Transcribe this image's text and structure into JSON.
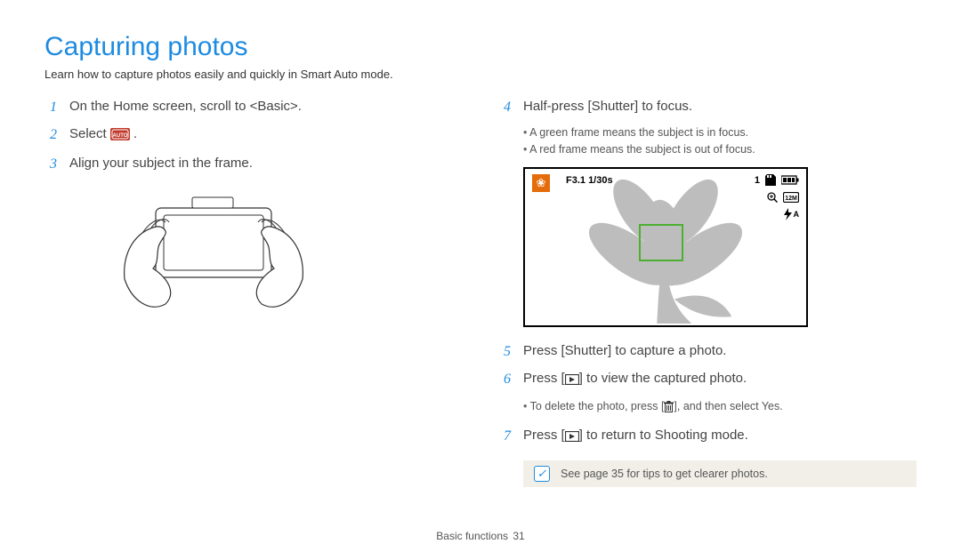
{
  "title": "Capturing photos",
  "intro": "Learn how to capture photos easily and quickly in Smart Auto mode.",
  "left": {
    "step1_num": "1",
    "step1_text": "On the Home screen, scroll to <Basic>.",
    "step2_num": "2",
    "step2_text_pre": "Select",
    "step2_text_post": ".",
    "step3_num": "3",
    "step3_text": "Align your subject in the frame."
  },
  "right": {
    "step4_num": "4",
    "step4_text": "Half-press [Shutter] to focus.",
    "step4_bullet1": "A green frame means the subject is in focus.",
    "step4_bullet2": "A red frame means the subject is out of focus.",
    "osd_exposure": "F3.1 1/30s",
    "osd_count": "1",
    "osd_flash_suffix": "A",
    "step5_num": "5",
    "step5_text": "Press [Shutter] to capture a photo.",
    "step6_num": "6",
    "step6_text_pre": "Press [",
    "step6_text_post": "] to view the captured photo.",
    "step6_bullet_pre": "To delete the photo, press [",
    "step6_bullet_post": "], and then select Yes.",
    "step7_num": "7",
    "step7_text_pre": "Press [",
    "step7_text_post": "] to return to Shooting mode.",
    "tip_text": "See page 35 for tips to get clearer photos."
  },
  "footer": {
    "section": "Basic functions",
    "page": "31"
  },
  "icons": {
    "smart_auto": "smart-auto-icon",
    "playback": "playback-icon",
    "trash": "trash-icon",
    "zoom": "zoom-icon",
    "battery": "battery-icon",
    "sd": "sd-card-icon",
    "flash_auto": "flash-auto-icon",
    "flower_scene": "flower-scene-icon"
  }
}
